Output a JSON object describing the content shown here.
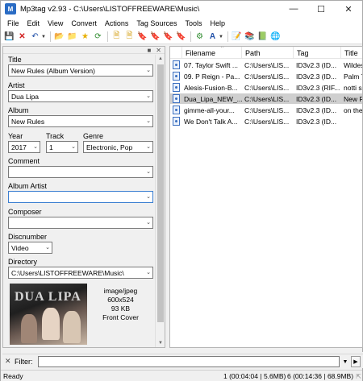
{
  "window": {
    "title": "Mp3tag v2.93  -  C:\\Users\\LISTOFFREEWARE\\Music\\",
    "app_icon": "mp3tag-app-icon",
    "controls": [
      "minimize-icon",
      "maximize-icon",
      "close-icon"
    ]
  },
  "menu": [
    "File",
    "Edit",
    "View",
    "Convert",
    "Actions",
    "Tag Sources",
    "Tools",
    "Help"
  ],
  "toolbar": {
    "icons": [
      "save-icon",
      "remove-icon",
      "undo-icon",
      "change-directory-icon",
      "add-directory-icon",
      "favorites-icon",
      "refresh-icon",
      "filename-tag-icon",
      "tag-filename-icon",
      "tag-tag-icon",
      "text-file-tag-icon",
      "export-icon",
      "auto-numbering-icon",
      "actions-icon",
      "case-conversion-icon",
      "options-icon",
      "help-icon",
      "about-icon",
      "web-icon"
    ]
  },
  "tag_panel": {
    "title_label": "Title",
    "title_value": "New Rules (Album Version)",
    "artist_label": "Artist",
    "artist_value": "Dua Lipa",
    "album_label": "Album",
    "album_value": "New Rules",
    "year_label": "Year",
    "year_value": "2017",
    "track_label": "Track",
    "track_value": "1",
    "genre_label": "Genre",
    "genre_value": "Electronic, Pop",
    "comment_label": "Comment",
    "comment_value": "",
    "album_artist_label": "Album Artist",
    "album_artist_value": "",
    "composer_label": "Composer",
    "composer_value": "",
    "discnumber_label": "Discnumber",
    "discnumber_value": "Video",
    "directory_label": "Directory",
    "directory_value": "C:\\Users\\LISTOFFREEWARE\\Music\\",
    "cover": {
      "logo_text": "DUA LIPA",
      "mime": "image/jpeg",
      "dimensions": "600x524",
      "size": "93 KB",
      "type": "Front Cover"
    }
  },
  "file_list": {
    "columns": [
      "Filename",
      "Path",
      "Tag",
      "Title"
    ],
    "rows": [
      {
        "filename": "07. Taylor Swift ...",
        "path": "C:\\Users\\LIS...",
        "tag": "ID3v2.3 (ID...",
        "title": "Wildes",
        "selected": false
      },
      {
        "filename": "09. P Reign - Pa...",
        "path": "C:\\Users\\LIS...",
        "tag": "ID3v2.3 (ID...",
        "title": "Palm T",
        "selected": false
      },
      {
        "filename": "Alesis-Fusion-B...",
        "path": "C:\\Users\\LIS...",
        "tag": "ID3v2.3 (RIF...",
        "title": "notti s",
        "selected": false
      },
      {
        "filename": "Dua_Lipa_NEW_...",
        "path": "C:\\Users\\LIS...",
        "tag": "ID3v2.3 (ID...",
        "title": "New R",
        "selected": true
      },
      {
        "filename": "gimme-all-your...",
        "path": "C:\\Users\\LIS...",
        "tag": "ID3v2.3 (ID...",
        "title": "on the",
        "selected": false
      },
      {
        "filename": "We Don't Talk A...",
        "path": "C:\\Users\\LIS...",
        "tag": "ID3v2.3 (ID...",
        "title": "",
        "selected": false
      }
    ]
  },
  "filter": {
    "label": "Filter:",
    "value": ""
  },
  "status": {
    "left": "Ready",
    "selected_info": "1 (00:04:04 | 5.6MB)",
    "total_info": "6 (00:14:36 | 68.9MB)"
  }
}
